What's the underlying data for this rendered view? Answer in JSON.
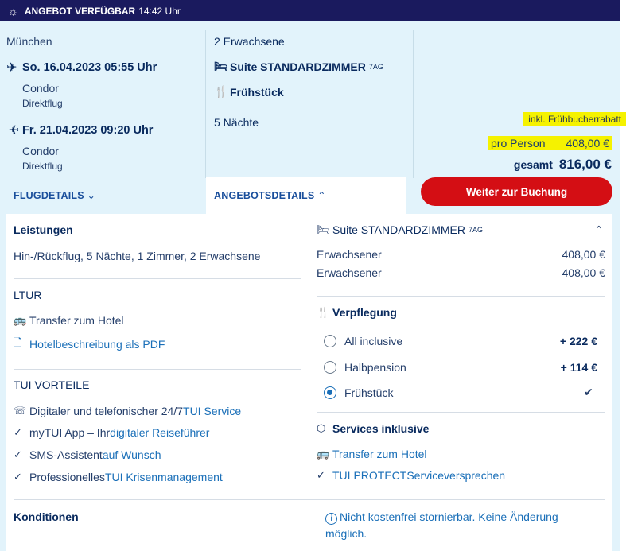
{
  "topbar": {
    "icon": "sun-icon",
    "title": "ANGEBOT VERFÜGBAR",
    "time": "14:42 Uhr"
  },
  "flight": {
    "origin": "München",
    "outbound": {
      "date": "So. 16.04.2023 05:55 Uhr",
      "airline": "Condor",
      "type": "Direktflug"
    },
    "inbound": {
      "date": "Fr. 21.04.2023 09:20 Uhr",
      "airline": "Condor",
      "type": "Direktflug"
    },
    "details_link": "FLUGDETAILS"
  },
  "offer": {
    "travellers": "2 Erwachsene",
    "room": "Suite STANDARDZIMMER",
    "room_code": "7AG",
    "board": "Frühstück",
    "nights": "5 Nächte",
    "details_link": "ANGEBOTSDETAILS"
  },
  "pricing": {
    "promo": "inkl. Frühbucherrabatt",
    "per_person_label": "pro Person",
    "per_person_value": "408,00 €",
    "total_label": "gesamt",
    "total_value": "816,00 €",
    "cta": "Weiter zur Buchung"
  },
  "services": {
    "title": "Leistungen",
    "summary": "Hin-/Rückflug, 5 Nächte, 1 Zimmer, 2 Erwachsene"
  },
  "ltur": {
    "title": "LTUR",
    "transfer": "Transfer zum Hotel",
    "pdf": "Hotelbeschreibung als PDF"
  },
  "tui": {
    "title": "TUI VORTEILE",
    "items": [
      {
        "a": "Digitaler und telefonischer 24/7 ",
        "b": "TUI Service"
      },
      {
        "a": "myTUI App – Ihr ",
        "b": "digitaler Reiseführer"
      },
      {
        "a": "SMS-Assistent ",
        "b": "auf Wunsch"
      },
      {
        "a": "Professionelles ",
        "b": "TUI Krisenmanagement"
      }
    ]
  },
  "room": {
    "name": "Suite STANDARDZIMMER",
    "code": "7AG",
    "rows": [
      {
        "label": "Erwachsener",
        "price": "408,00 €"
      },
      {
        "label": "Erwachsener",
        "price": "408,00 €"
      }
    ]
  },
  "board": {
    "title": "Verpflegung",
    "options": [
      {
        "label": "All inclusive",
        "price": "+ 222 €"
      },
      {
        "label": "Halbpension",
        "price": "+ 114 €"
      },
      {
        "label": "Frühstück",
        "price": ""
      }
    ],
    "selected": "Frühstück"
  },
  "included": {
    "title": "Services inklusive",
    "transfer": "Transfer zum Hotel",
    "protect_a": "TUI PROTECT",
    "protect_b": " Serviceversprechen"
  },
  "conditions": {
    "title": "Konditionen",
    "text": "Nicht kostenfrei stornierbar. Keine Änderung möglich."
  }
}
